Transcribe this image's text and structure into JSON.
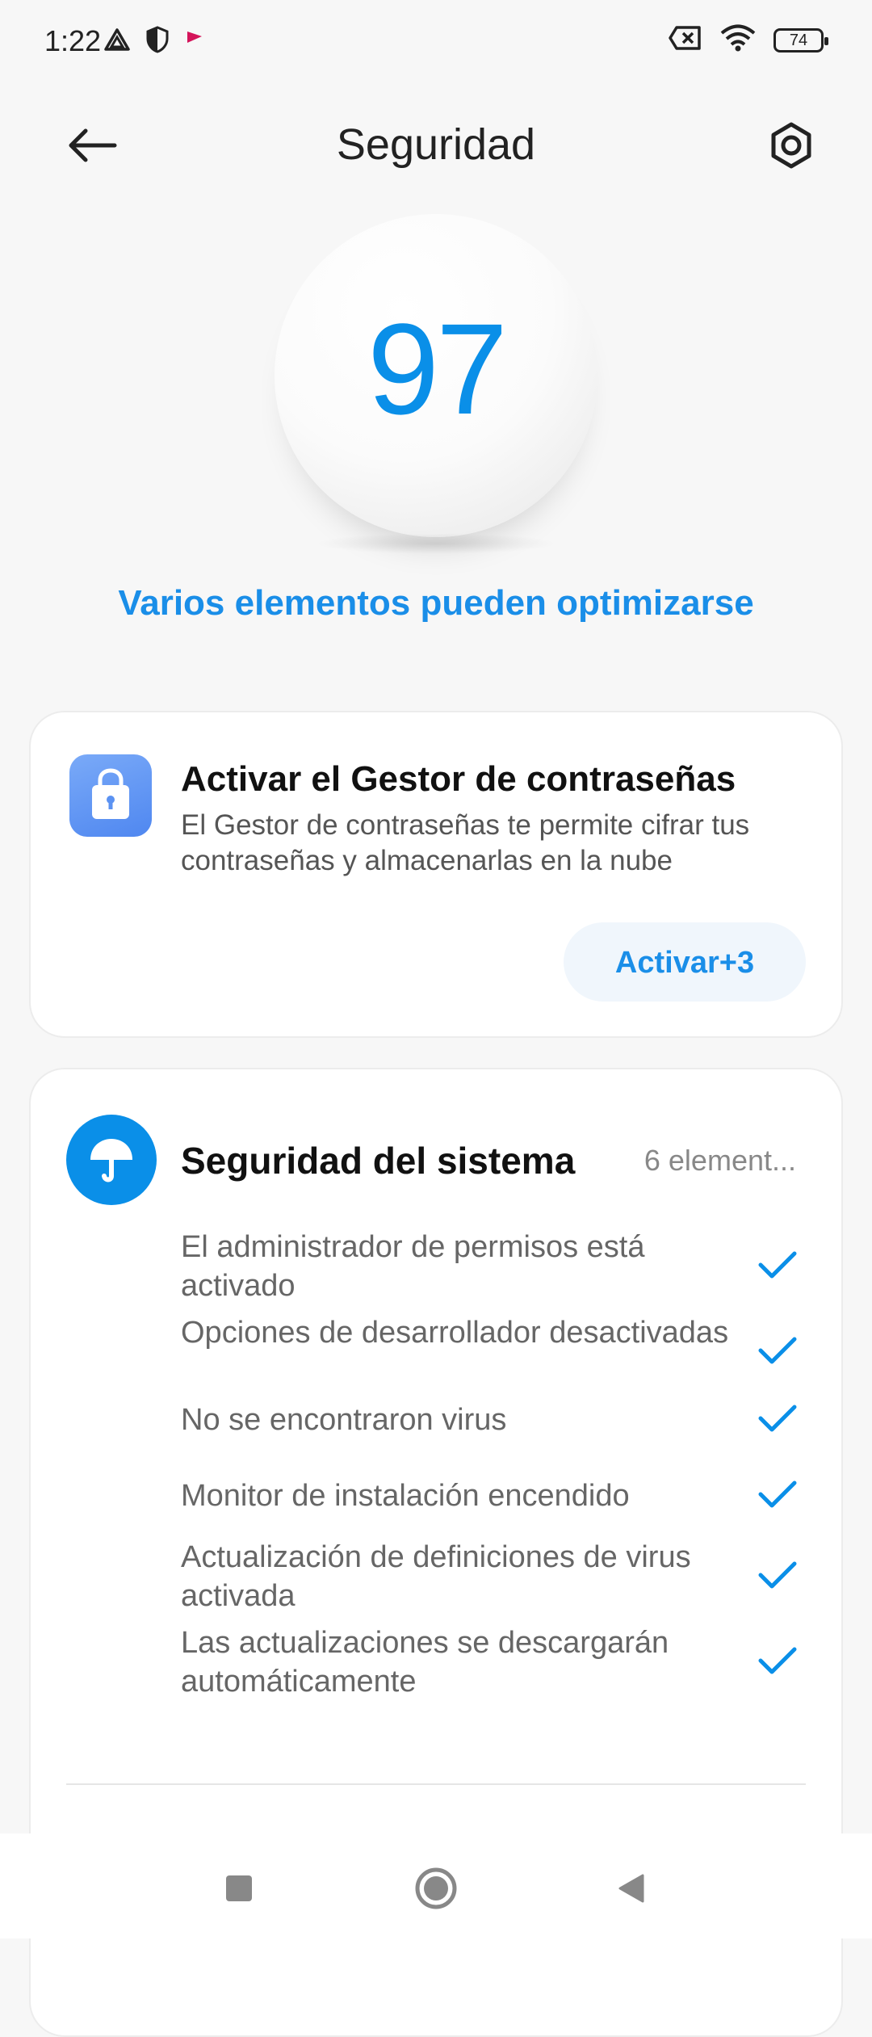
{
  "status_bar": {
    "time": "1:22",
    "battery": "74",
    "icons_left": [
      "drive-icon",
      "shield-icon",
      "flag-icon"
    ],
    "icons_right": [
      "no-sim-icon",
      "wifi-icon",
      "battery-icon"
    ]
  },
  "header": {
    "title": "Seguridad"
  },
  "score": {
    "value": "97",
    "message": "Varios elementos pueden optimizarse"
  },
  "password_manager_card": {
    "title": "Activar el Gestor de contraseñas",
    "description": "El Gestor de contraseñas te permite cifrar tus contraseñas y almacenarlas en la nube",
    "button_label": "Activar+3"
  },
  "system_security_card": {
    "title": "Seguridad del sistema",
    "count": "6 element...",
    "items": [
      {
        "label": "El administrador de permisos está activado"
      },
      {
        "label": "Opciones de desarrollador desactivadas"
      },
      {
        "label": "No se encontraron virus"
      },
      {
        "label": "Monitor de instalación encendido"
      },
      {
        "label": "Actualización de definiciones de virus activada"
      },
      {
        "label": "Las actualizaciones se descargarán automáticamente"
      }
    ]
  },
  "colors": {
    "accent": "#0a8fe8",
    "background": "#f7f7f7",
    "card": "#ffffff"
  }
}
